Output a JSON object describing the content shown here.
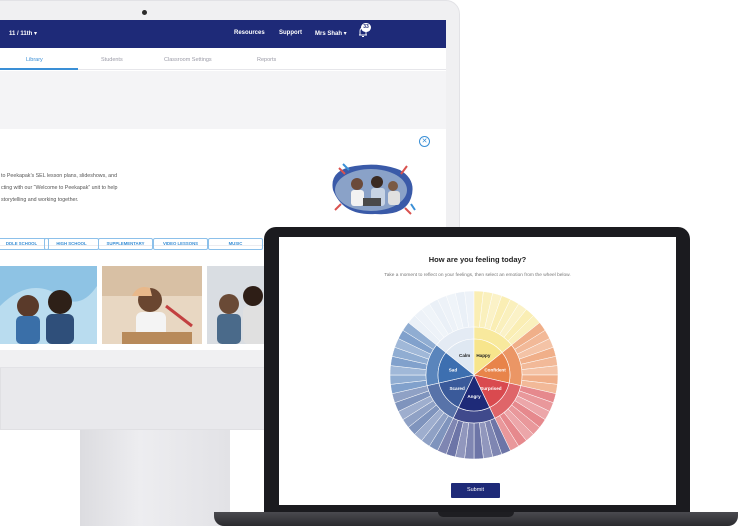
{
  "desktop": {
    "topbar": {
      "grade_selector": "11 / 11th ▾",
      "resources": "Resources",
      "support": "Support",
      "user_menu": "Mrs Shah ▾",
      "notification_count": "33"
    },
    "tabs": [
      {
        "label": "Library",
        "active": true
      },
      {
        "label": "Students",
        "active": false
      },
      {
        "label": "Classroom Settings",
        "active": false
      },
      {
        "label": "Reports",
        "active": false
      }
    ],
    "welcome": {
      "lines": [
        "to Peekapak’s SEL lesson plans, slideshows, and",
        "cting with our “Welcome to Peekapak” unit to help",
        "storytelling and working together."
      ],
      "close_icon": "✕"
    },
    "filters": [
      "DDLE SCHOOL",
      "HIGH SCHOOL",
      "SUPPLEMENTARY",
      "VIDEO LESSONS",
      "MUSIC"
    ]
  },
  "laptop": {
    "title": "How are you feeling today?",
    "subtitle": "Take a moment to reflect on your feelings, then select an emotion from the wheel below.",
    "wheel_core": [
      {
        "label": "Calm",
        "color": "#dfe8f2"
      },
      {
        "label": "Happy",
        "color": "#f7e58c"
      },
      {
        "label": "Confident",
        "color": "#e8844a"
      },
      {
        "label": "Surprised",
        "color": "#d94a4f"
      },
      {
        "label": "Angry",
        "color": "#1e2a78"
      },
      {
        "label": "Scared",
        "color": "#3a5a9a"
      },
      {
        "label": "Sad",
        "color": "#3d6fb0"
      }
    ],
    "submit_label": "Submit"
  }
}
